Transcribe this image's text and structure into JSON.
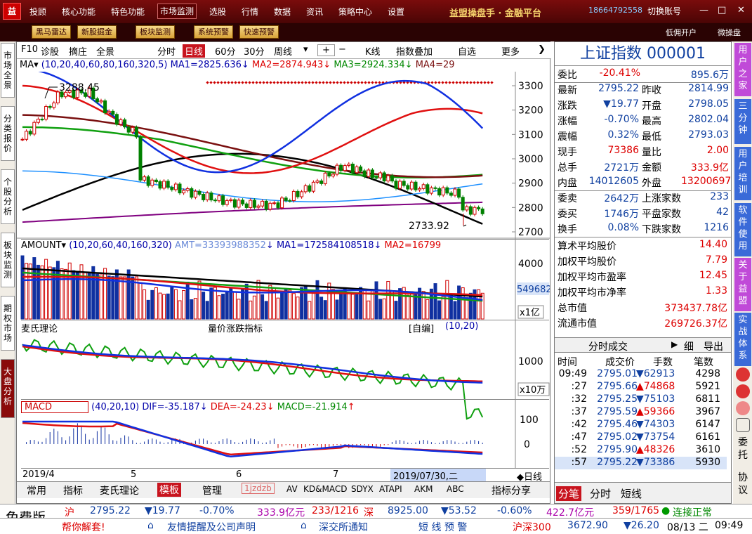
{
  "app": {
    "logo": "益",
    "brand": "益盟操盘手 · 金融平台",
    "phone": "18664792558",
    "switch_account": "切换账号",
    "window_buttons": [
      "—",
      "□",
      "✕"
    ]
  },
  "top_menu": [
    "投顾",
    "核心功能",
    "特色功能",
    "市场监测",
    "选股",
    "行情",
    "数据",
    "资讯",
    "策略中心",
    "设置"
  ],
  "toolbar2": {
    "buttons": [
      "黑马雷达",
      "新股掘金",
      "板块监测",
      "系统预警",
      "快速预警"
    ],
    "right": [
      "低佣开户",
      "微操盘"
    ]
  },
  "left_tabs": [
    "市场全景",
    "分类报价",
    "个股分析",
    "板块监测",
    "期权市场",
    "大盘分析"
  ],
  "chart_toolbar": [
    "F10",
    "诊股",
    "摘庄",
    "全景",
    "分时",
    "日线",
    "60分",
    "30分",
    "周线",
    "K线",
    "指数叠加",
    "自选",
    "更多"
  ],
  "ma_bar": {
    "label": "MA",
    "params": "(10,20,40,60,80,160,320,5)",
    "ma1": "MA1=2825.636",
    "ma2": "MA2=2874.943",
    "ma3": "MA3=2924.334",
    "ma4": "MA4=29"
  },
  "price_axis": [
    "3300",
    "3200",
    "3100",
    "3000",
    "2900",
    "2800",
    "2700"
  ],
  "price_annotations": {
    "high": "3288.45",
    "low": "2733.92"
  },
  "amount_bar": {
    "label": "AMOUNT",
    "params": "(10,20,60,40,160,320)",
    "amt": "AMT=33393988352",
    "ma1": "MA1=172584108518",
    "ma2": "MA2=16799",
    "axis": "4000",
    "unit": "x1亿",
    "side_value": "549682"
  },
  "mai_bar": {
    "label": "麦氏理论",
    "title": "量价涨跌指标",
    "mode": "[自编]",
    "params": "(10,20)",
    "axis": "1000",
    "unit": "x10万"
  },
  "macd_bar": {
    "label": "MACD",
    "params": "(40,20,10)",
    "dif": "DIF=-35.187",
    "dea": "DEA=-24.23",
    "macd": "MACD=-21.914",
    "axis": [
      "100",
      "0"
    ]
  },
  "date_axis": {
    "d1": "2019/4",
    "d2": "5",
    "d3": "6",
    "d4": "7",
    "cursor": "2019/07/30,二",
    "mode": "日线"
  },
  "bottom_tabs": [
    "常用",
    "指标",
    "麦氏理论",
    "模板",
    "管理",
    "1jzdzb",
    "AV",
    "KD&MACD",
    "SDYX",
    "ATAPI",
    "AKM",
    "ABC",
    "指标分享"
  ],
  "quote": {
    "title": "上证指数 000001",
    "rows": [
      [
        "委比",
        "-20.41%",
        "895.6万"
      ],
      [
        "最新",
        "2795.22",
        "昨收",
        "2814.99"
      ],
      [
        "涨跌",
        "▼19.77",
        "开盘",
        "2798.05"
      ],
      [
        "涨幅",
        "-0.70%",
        "最高",
        "2802.04"
      ],
      [
        "震幅",
        "0.32%",
        "最低",
        "2793.03"
      ],
      [
        "现手",
        "73386",
        "量比",
        "2.00"
      ],
      [
        "总手",
        "2721万",
        "金额",
        "333.9亿"
      ],
      [
        "内盘",
        "14012605",
        "外盘",
        "13200697"
      ],
      [
        "委卖",
        "2642万",
        "上涨家数",
        "233"
      ],
      [
        "委买",
        "1746万",
        "平盘家数",
        "42"
      ],
      [
        "换手",
        "0.08%",
        "下跌家数",
        "1216"
      ]
    ],
    "stats": [
      [
        "算术平均股价",
        "14.40"
      ],
      [
        "加权平均股价",
        "7.79"
      ],
      [
        "加权平均市盈率",
        "12.45"
      ],
      [
        "加权平均市净率",
        "1.33"
      ],
      [
        "总市值",
        "373437.78亿"
      ],
      [
        "流通市值",
        "269726.37亿"
      ]
    ],
    "trades_title": "分时成交",
    "trades_btn": [
      "细",
      "导出"
    ],
    "trades_header": [
      "时间",
      "成交价",
      "手数",
      "笔数"
    ],
    "trades": [
      [
        "09:49",
        "2795.01",
        "▼62913",
        "4298"
      ],
      [
        ":27",
        "2795.66",
        "▲74868",
        "5921"
      ],
      [
        ":32",
        "2795.25",
        "▼75103",
        "6811"
      ],
      [
        ":37",
        "2795.59",
        "▲59366",
        "3967"
      ],
      [
        ":42",
        "2795.46",
        "▼74303",
        "6147"
      ],
      [
        ":47",
        "2795.02",
        "▼73754",
        "6161"
      ],
      [
        ":52",
        "2795.90",
        "▲48326",
        "3610"
      ],
      [
        ":57",
        "2795.22",
        "▼73386",
        "5930"
      ]
    ],
    "bottom_tabs": [
      "分笔",
      "分时",
      "短线"
    ]
  },
  "right_bar": [
    "用户之家",
    "三分钟",
    "用户培训",
    "软件使用",
    "关于益盟",
    "实战体系",
    "委托",
    "协议"
  ],
  "status1": {
    "free": "免费版",
    "sh": "沪",
    "sh_price": "2795.22",
    "sh_chg": "▼19.77",
    "sh_pct": "-0.70%",
    "sh_amt": "333.9亿元",
    "sh_ud": "233/1216",
    "sz": "深",
    "sz_price": "8925.00",
    "sz_chg": "▼53.52",
    "sz_pct": "-0.60%",
    "sz_amt": "422.7亿元",
    "sz_ud": "359/1765",
    "conn": "连接正常"
  },
  "status2": {
    "t1": "帮你解套!",
    "t2": "友情提醒及公司声明",
    "t3": "深交所通知",
    "t4": "短 线 预 警",
    "hs": "沪深300",
    "hs_price": "3672.90",
    "hs_chg": "▼26.20",
    "date": "08/13 二",
    "time": "09:49"
  },
  "colors": {
    "up": "#d00000",
    "down": "#008000",
    "ma1": "#1030e0",
    "ma2": "#e01010",
    "ma3": "#10a010",
    "ma4": "#7a1010",
    "ma5": "#000000",
    "ma6": "#1e90ff",
    "ma7": "#800080"
  }
}
